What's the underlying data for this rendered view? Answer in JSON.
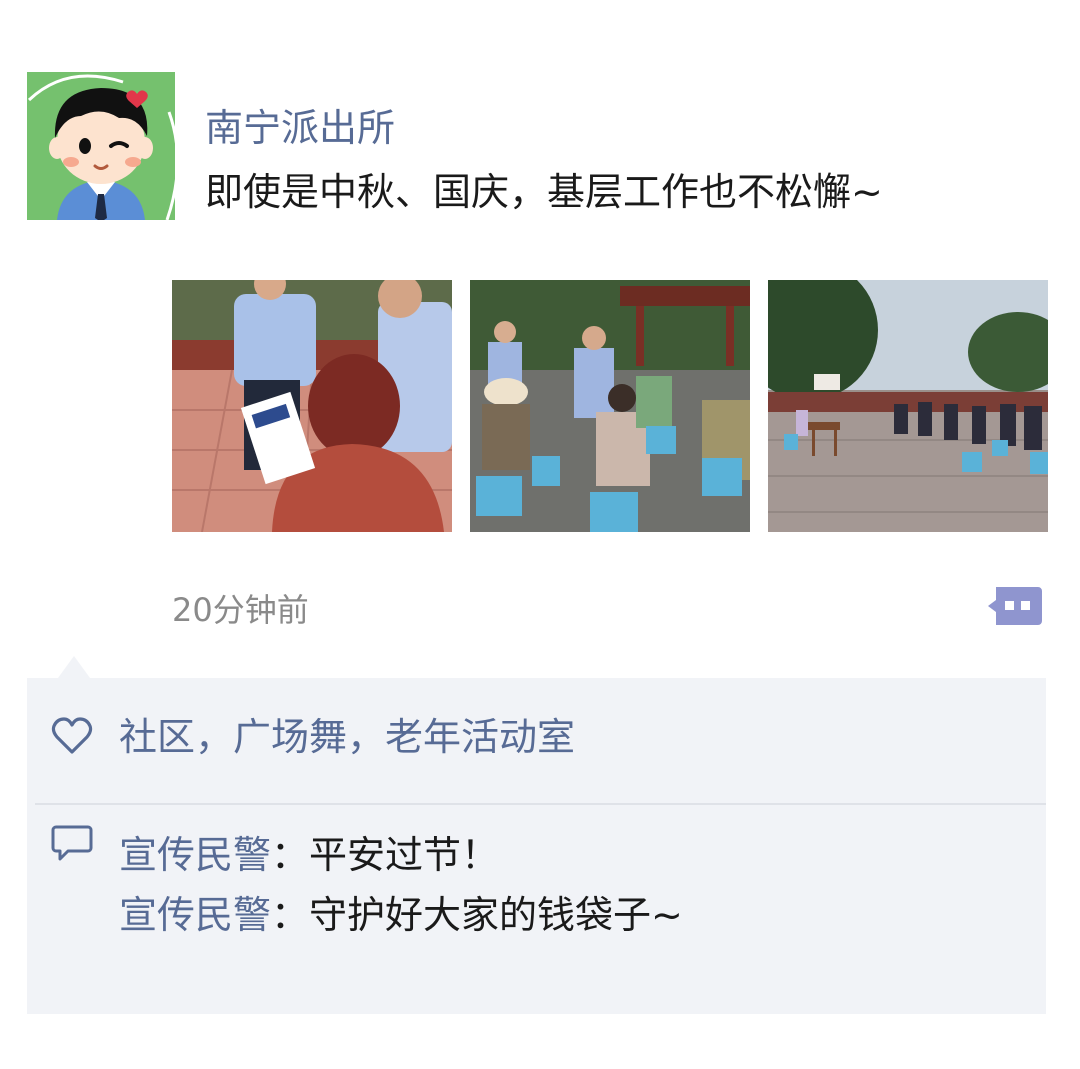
{
  "post": {
    "author": "南宁派出所",
    "text": "即使是中秋、国庆，基层工作也不松懈~",
    "time": "20分钟前"
  },
  "photos": [
    {
      "description": "police handing out leaflets"
    },
    {
      "description": "audience seated on stools"
    },
    {
      "description": "square seating at dusk"
    }
  ],
  "likes": {
    "text": "社区，广场舞，老年活动室",
    "icon": "heart-icon"
  },
  "comments": [
    {
      "name": "宣传民警",
      "separator": "：",
      "text": "平安过节！"
    },
    {
      "name": "宣传民警",
      "separator": "：",
      "text": "守护好大家的钱袋子~"
    }
  ],
  "colors": {
    "link": "#576b95",
    "panel": "#f1f3f7",
    "avatar_bg": "#75c16e",
    "more_button": "#8f95cf"
  }
}
